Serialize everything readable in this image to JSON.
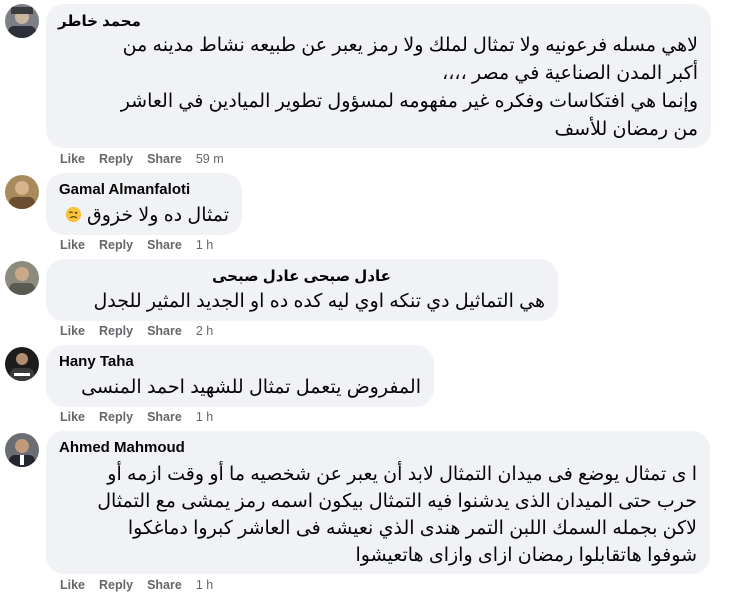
{
  "actions": {
    "like": "Like",
    "reply": "Reply",
    "share": "Share"
  },
  "comments": [
    {
      "author": "محمد خاطر",
      "lines": [
        "لاهي مسله فرعونيه ولا تمثال لملك ولا رمز يعبر عن طبيعه نشاط مدينه من",
        "أكبر المدن الصناعية في مصر ،،،،",
        "وإنما هي افتكاسات وفكره غير مفهومه لمسؤول تطوير الميادين في العاشر",
        "من رمضان للأسف"
      ],
      "time": "59 m"
    },
    {
      "author": "Gamal Almanfaloti",
      "lines": [
        "تمثال ده ولا خزوق"
      ],
      "emoji": "woozy-face-icon",
      "time": "1 h"
    },
    {
      "author": "عادل صبحى عادل صبحى",
      "lines": [
        "هي التماثيل دي تنكه اوي ليه كده ده او الجديد المثير للجدل"
      ],
      "time": "2 h"
    },
    {
      "author": "Hany Taha",
      "lines": [
        "المفروض يتعمل تمثال للشهيد احمد المنسى"
      ],
      "time": "1 h"
    },
    {
      "author": "Ahmed Mahmoud",
      "lines": [
        "ا ى تمثال يوضع فى ميدان التمثال لابد أن يعبر عن شخصيه ما أو وقت ازمه أو",
        "حرب حتى الميدان الذى يدشنوا فيه التمثال بيكون اسمه رمز يمشى مع التمثال",
        "لاكن بجمله السمك اللبن التمر هندى الذي نعيشه فى العاشر كبروا دماغكوا",
        "شوفوا هاتقابلوا رمضان ازاى وازاى هاتعيشوا"
      ],
      "time": "1 h"
    }
  ]
}
